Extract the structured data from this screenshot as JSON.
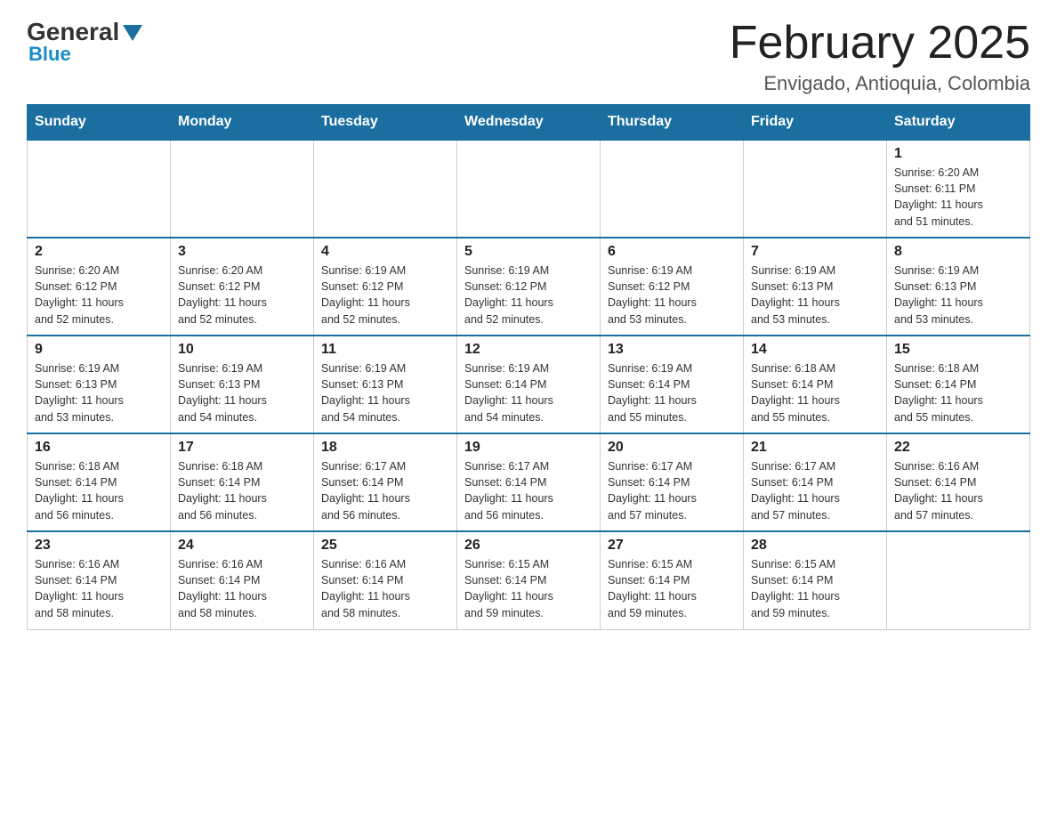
{
  "header": {
    "logo_general": "General",
    "logo_blue": "Blue",
    "month_title": "February 2025",
    "location": "Envigado, Antioquia, Colombia"
  },
  "days_of_week": [
    "Sunday",
    "Monday",
    "Tuesday",
    "Wednesday",
    "Thursday",
    "Friday",
    "Saturday"
  ],
  "weeks": [
    [
      {
        "num": "",
        "info": ""
      },
      {
        "num": "",
        "info": ""
      },
      {
        "num": "",
        "info": ""
      },
      {
        "num": "",
        "info": ""
      },
      {
        "num": "",
        "info": ""
      },
      {
        "num": "",
        "info": ""
      },
      {
        "num": "1",
        "info": "Sunrise: 6:20 AM\nSunset: 6:11 PM\nDaylight: 11 hours\nand 51 minutes."
      }
    ],
    [
      {
        "num": "2",
        "info": "Sunrise: 6:20 AM\nSunset: 6:12 PM\nDaylight: 11 hours\nand 52 minutes."
      },
      {
        "num": "3",
        "info": "Sunrise: 6:20 AM\nSunset: 6:12 PM\nDaylight: 11 hours\nand 52 minutes."
      },
      {
        "num": "4",
        "info": "Sunrise: 6:19 AM\nSunset: 6:12 PM\nDaylight: 11 hours\nand 52 minutes."
      },
      {
        "num": "5",
        "info": "Sunrise: 6:19 AM\nSunset: 6:12 PM\nDaylight: 11 hours\nand 52 minutes."
      },
      {
        "num": "6",
        "info": "Sunrise: 6:19 AM\nSunset: 6:12 PM\nDaylight: 11 hours\nand 53 minutes."
      },
      {
        "num": "7",
        "info": "Sunrise: 6:19 AM\nSunset: 6:13 PM\nDaylight: 11 hours\nand 53 minutes."
      },
      {
        "num": "8",
        "info": "Sunrise: 6:19 AM\nSunset: 6:13 PM\nDaylight: 11 hours\nand 53 minutes."
      }
    ],
    [
      {
        "num": "9",
        "info": "Sunrise: 6:19 AM\nSunset: 6:13 PM\nDaylight: 11 hours\nand 53 minutes."
      },
      {
        "num": "10",
        "info": "Sunrise: 6:19 AM\nSunset: 6:13 PM\nDaylight: 11 hours\nand 54 minutes."
      },
      {
        "num": "11",
        "info": "Sunrise: 6:19 AM\nSunset: 6:13 PM\nDaylight: 11 hours\nand 54 minutes."
      },
      {
        "num": "12",
        "info": "Sunrise: 6:19 AM\nSunset: 6:14 PM\nDaylight: 11 hours\nand 54 minutes."
      },
      {
        "num": "13",
        "info": "Sunrise: 6:19 AM\nSunset: 6:14 PM\nDaylight: 11 hours\nand 55 minutes."
      },
      {
        "num": "14",
        "info": "Sunrise: 6:18 AM\nSunset: 6:14 PM\nDaylight: 11 hours\nand 55 minutes."
      },
      {
        "num": "15",
        "info": "Sunrise: 6:18 AM\nSunset: 6:14 PM\nDaylight: 11 hours\nand 55 minutes."
      }
    ],
    [
      {
        "num": "16",
        "info": "Sunrise: 6:18 AM\nSunset: 6:14 PM\nDaylight: 11 hours\nand 56 minutes."
      },
      {
        "num": "17",
        "info": "Sunrise: 6:18 AM\nSunset: 6:14 PM\nDaylight: 11 hours\nand 56 minutes."
      },
      {
        "num": "18",
        "info": "Sunrise: 6:17 AM\nSunset: 6:14 PM\nDaylight: 11 hours\nand 56 minutes."
      },
      {
        "num": "19",
        "info": "Sunrise: 6:17 AM\nSunset: 6:14 PM\nDaylight: 11 hours\nand 56 minutes."
      },
      {
        "num": "20",
        "info": "Sunrise: 6:17 AM\nSunset: 6:14 PM\nDaylight: 11 hours\nand 57 minutes."
      },
      {
        "num": "21",
        "info": "Sunrise: 6:17 AM\nSunset: 6:14 PM\nDaylight: 11 hours\nand 57 minutes."
      },
      {
        "num": "22",
        "info": "Sunrise: 6:16 AM\nSunset: 6:14 PM\nDaylight: 11 hours\nand 57 minutes."
      }
    ],
    [
      {
        "num": "23",
        "info": "Sunrise: 6:16 AM\nSunset: 6:14 PM\nDaylight: 11 hours\nand 58 minutes."
      },
      {
        "num": "24",
        "info": "Sunrise: 6:16 AM\nSunset: 6:14 PM\nDaylight: 11 hours\nand 58 minutes."
      },
      {
        "num": "25",
        "info": "Sunrise: 6:16 AM\nSunset: 6:14 PM\nDaylight: 11 hours\nand 58 minutes."
      },
      {
        "num": "26",
        "info": "Sunrise: 6:15 AM\nSunset: 6:14 PM\nDaylight: 11 hours\nand 59 minutes."
      },
      {
        "num": "27",
        "info": "Sunrise: 6:15 AM\nSunset: 6:14 PM\nDaylight: 11 hours\nand 59 minutes."
      },
      {
        "num": "28",
        "info": "Sunrise: 6:15 AM\nSunset: 6:14 PM\nDaylight: 11 hours\nand 59 minutes."
      },
      {
        "num": "",
        "info": ""
      }
    ]
  ]
}
